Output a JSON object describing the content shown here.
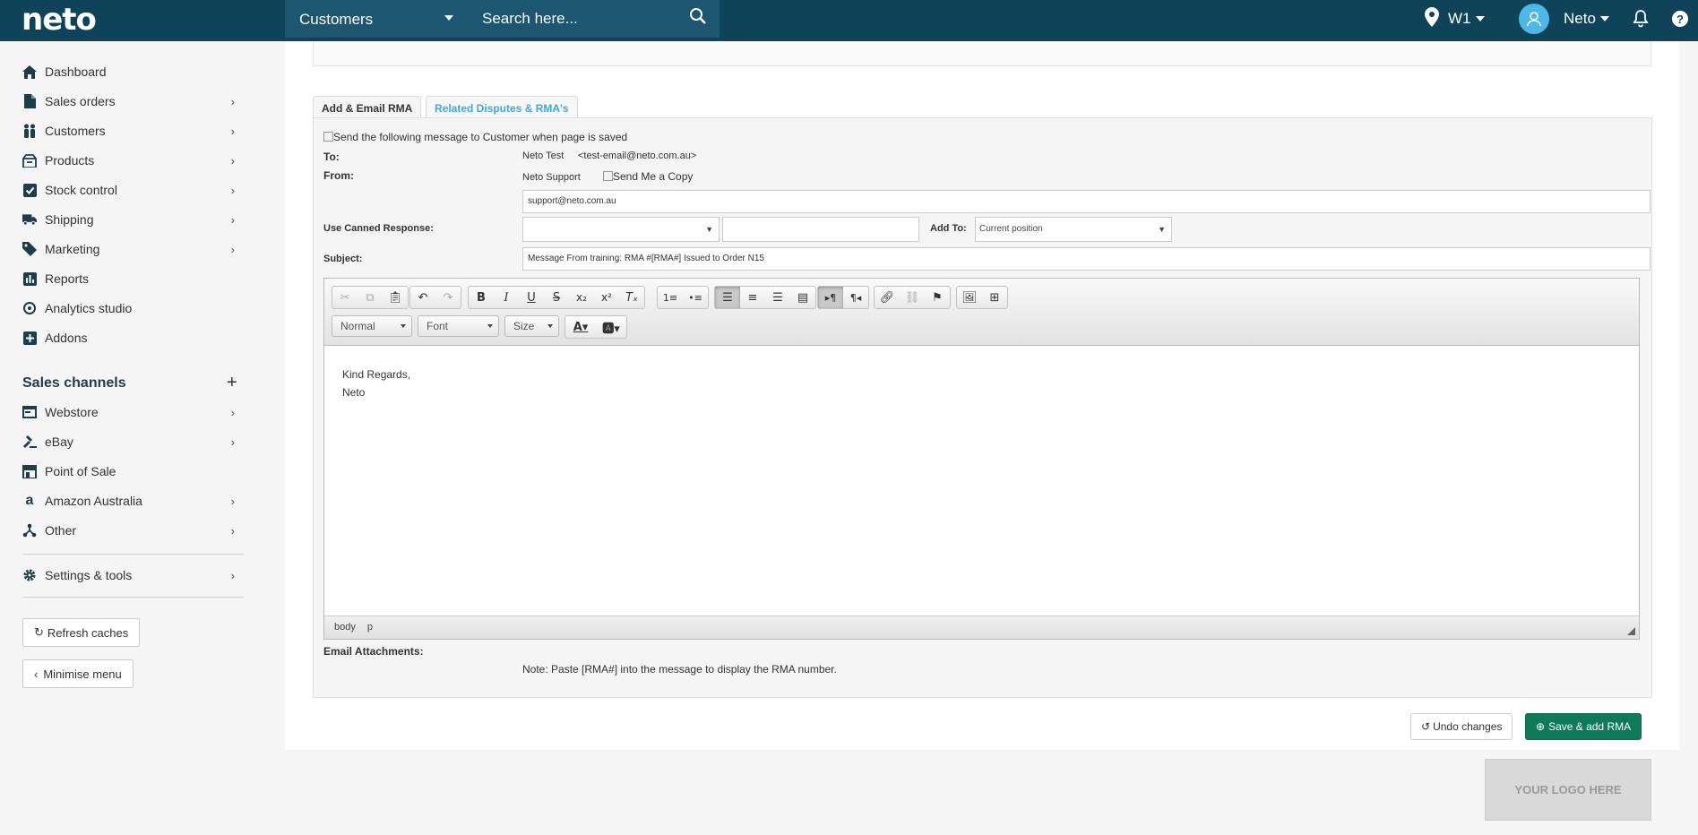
{
  "app": {
    "logo": "neto"
  },
  "header": {
    "search_category": "Customers",
    "search_placeholder": "Search here...",
    "location": "W1",
    "user": "Neto"
  },
  "sidebar": {
    "items": [
      {
        "label": "Dashboard",
        "icon": "home-icon"
      },
      {
        "label": "Sales orders",
        "icon": "document-icon"
      },
      {
        "label": "Customers",
        "icon": "users-icon"
      },
      {
        "label": "Products",
        "icon": "box-icon"
      },
      {
        "label": "Stock control",
        "icon": "checkbox-icon"
      },
      {
        "label": "Shipping",
        "icon": "truck-icon"
      },
      {
        "label": "Marketing",
        "icon": "tag-icon"
      },
      {
        "label": "Reports",
        "icon": "bar-chart-icon"
      },
      {
        "label": "Analytics studio",
        "icon": "analytics-icon"
      },
      {
        "label": "Addons",
        "icon": "plus-square-icon"
      }
    ],
    "channels_heading": "Sales channels",
    "channels": [
      {
        "label": "Webstore",
        "icon": "browser-icon"
      },
      {
        "label": "eBay",
        "icon": "gavel-icon"
      },
      {
        "label": "Point of Sale",
        "icon": "store-icon"
      },
      {
        "label": "Amazon Australia",
        "icon": "amazon-icon"
      },
      {
        "label": "Other",
        "icon": "network-icon"
      }
    ],
    "settings": "Settings & tools",
    "refresh_button": "Refresh caches",
    "minimise_button": "Minimise menu"
  },
  "tabs": [
    "Add & Email RMA",
    "Related Disputes & RMA's"
  ],
  "form": {
    "send_message_label": "Send the following message to Customer when page is saved",
    "to_label": "To:",
    "to_name": "Neto Test",
    "to_email": "<test-email@neto.com.au>",
    "from_label": "From:",
    "from_name": "Neto Support",
    "send_copy_label": "Send Me a Copy",
    "from_email": "support@neto.com.au",
    "canned_label": "Use Canned Response:",
    "add_to_label": "Add To:",
    "add_to_value": "Current position",
    "subject_label": "Subject:",
    "subject_value": "Message From training: RMA #[RMA#] Issued to Order N15",
    "attachments_label": "Email Attachments:",
    "note": "Note: Paste [RMA#] into the message to display the RMA number."
  },
  "editor": {
    "format_combo": "Normal",
    "font_combo": "Font",
    "size_combo": "Size",
    "body_line1": "Kind Regards,",
    "body_line2": "Neto",
    "path_body": "body",
    "path_p": "p"
  },
  "actions": {
    "undo": "Undo changes",
    "save": "Save & add RMA"
  },
  "footer_logo": "YOUR LOGO HERE",
  "colors": {
    "topbar": "#0f4359",
    "primary": "#0f7a58",
    "link": "#41a9d8"
  }
}
